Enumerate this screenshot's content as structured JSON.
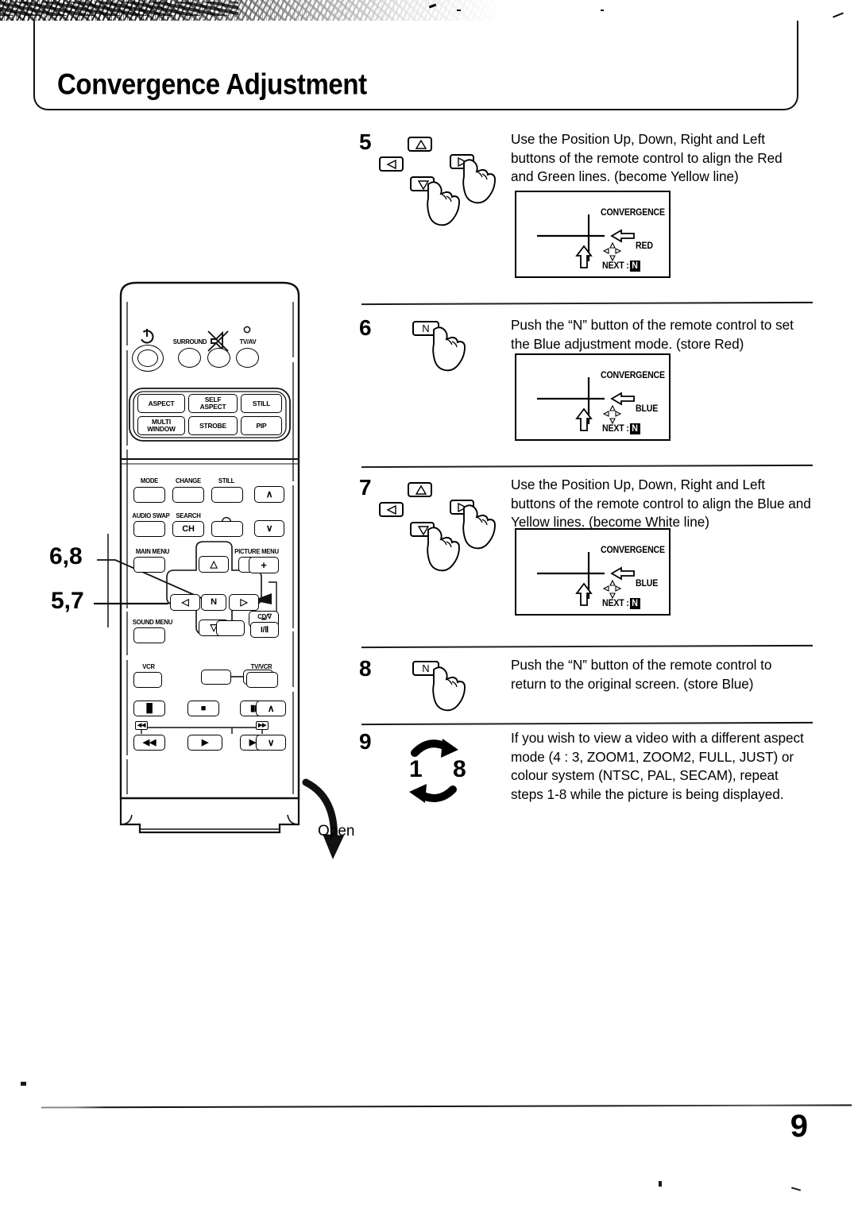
{
  "document": {
    "title": "Convergence Adjustment",
    "page_number": "9"
  },
  "remote": {
    "open_label": "Open",
    "callouts": [
      {
        "label": "6,8",
        "points_to": "n-button"
      },
      {
        "label": "5,7",
        "points_to": "direction-pad"
      }
    ],
    "top_row": [
      {
        "name": "power",
        "label": ""
      },
      {
        "name": "surround",
        "label": "SURROUND"
      },
      {
        "name": "mute",
        "label": ""
      },
      {
        "name": "tv-av",
        "label": "TV/AV"
      }
    ],
    "aspect_pad": [
      {
        "label": "ASPECT"
      },
      {
        "label": "SELF\nASPECT"
      },
      {
        "label": "STILL"
      },
      {
        "label": "MULTI\nWINDOW"
      },
      {
        "label": "STROBE"
      },
      {
        "label": "PIP"
      }
    ],
    "mid_rows": {
      "row1": [
        "MODE",
        "CHANGE",
        "STILL"
      ],
      "row1_side": "∧",
      "row2": [
        "AUDIO SWAP",
        "SEARCH",
        ""
      ],
      "row2_search_cap": "CH",
      "row2_side": "∨",
      "row3": [
        "MAIN MENU",
        "PICTURE MENU"
      ],
      "row3_side_plus": "+",
      "row3_side_minus": "−",
      "pad_up": "△",
      "pad_left": "◁",
      "pad_center": "N",
      "pad_right": "▷",
      "pad_down": "▽",
      "row4": [
        "SOUND MENU"
      ],
      "row4_side": "CD/∇",
      "row4_side_cap": "I/Ⅱ"
    },
    "vcr_rows": {
      "vcr_label": "VCR",
      "tv_vcr_label": "TV/VCR",
      "transport_row1": [
        "▐▌",
        "■",
        "▮▶",
        "∧"
      ],
      "transport_row2": [
        "◀◀",
        "▶",
        "▶▶",
        "∨"
      ]
    }
  },
  "steps": [
    {
      "number": "5",
      "icon": "direction-pad-with-hands",
      "text": "Use the Position Up, Down, Right and Left buttons of the remote control to align the Red and Green lines. (become Yellow line)",
      "osd": {
        "title": "CONVERGENCE",
        "colour": "RED",
        "next_label": "NEXT :",
        "next_key": "N"
      }
    },
    {
      "number": "6",
      "icon": "n-button-with-hand",
      "text": "Push the “N” button of the remote control to set the Blue adjustment mode. (store Red)",
      "osd": {
        "title": "CONVERGENCE",
        "colour": "BLUE",
        "next_label": "NEXT :",
        "next_key": "N"
      }
    },
    {
      "number": "7",
      "icon": "direction-pad-with-hands",
      "text": "Use the Position Up, Down, Right and Left buttons of the remote control to align the Blue and Yellow lines. (become White line)",
      "osd": {
        "title": "CONVERGENCE",
        "colour": "BLUE",
        "next_label": "NEXT :",
        "next_key": "N"
      }
    },
    {
      "number": "8",
      "icon": "n-button-with-hand",
      "text": "Push the “N” button of the remote control to return to the original screen. (store Blue)",
      "osd": null
    },
    {
      "number": "9",
      "icon": "repeat-cycle",
      "icon_start": "1",
      "icon_end": "8",
      "text": "If you wish to view a video with a different aspect mode (4 : 3, ZOOM1, ZOOM2, FULL, JUST) or colour system (NTSC, PAL, SECAM), repeat steps 1-8 while the picture is being displayed.",
      "osd": null
    }
  ],
  "key_glyphs": {
    "up": "△",
    "down": "▽",
    "left": "◁",
    "right": "▷",
    "n": "N"
  }
}
